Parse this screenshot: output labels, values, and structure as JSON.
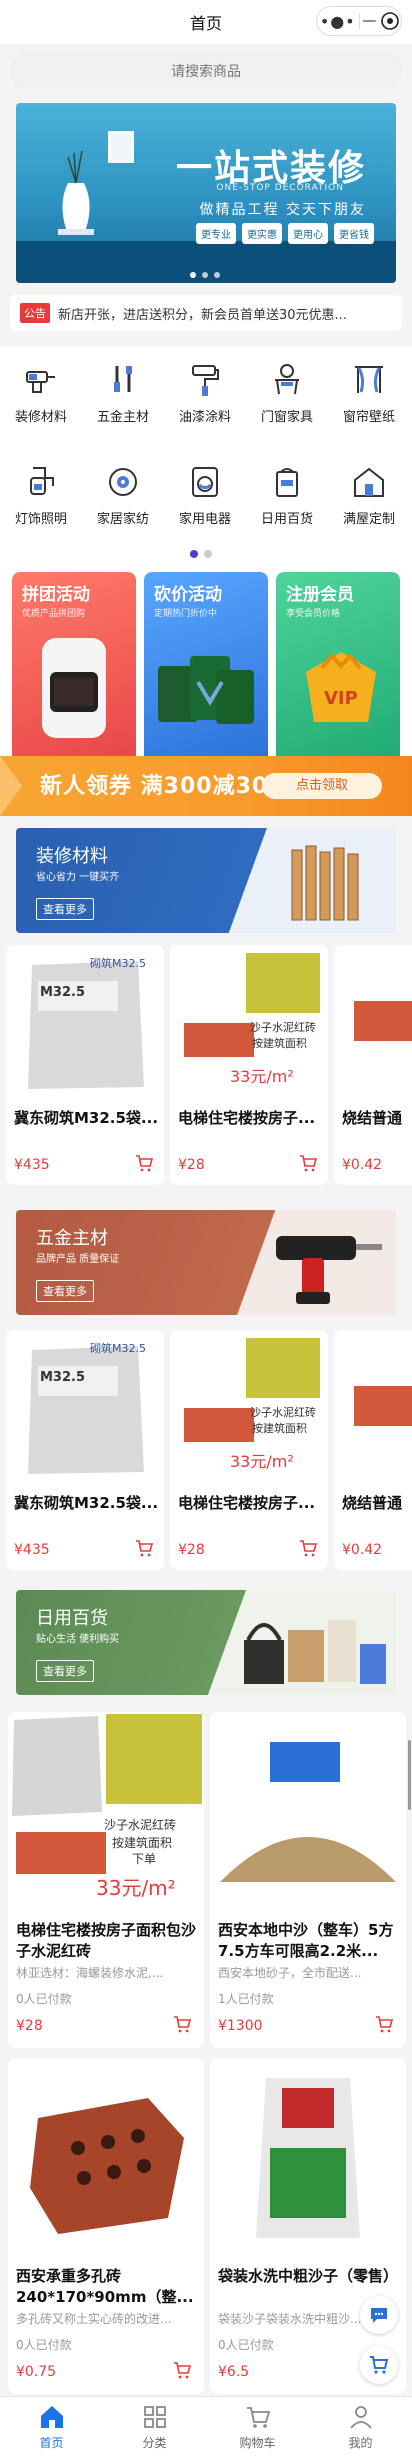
{
  "header": {
    "title": "首页",
    "more_icon": "more-dots-icon",
    "close_icon": "target-circle-icon"
  },
  "search": {
    "placeholder": "请搜索商品"
  },
  "banner": {
    "headline": "一站式装修",
    "sub_en": "ONE-STOP DECORATION",
    "slogan": "做精品工程  交天下朋友",
    "tags": [
      "更专业",
      "更实惠",
      "更用心",
      "更省钱"
    ]
  },
  "notice": {
    "badge": "公告",
    "text": "新店开张，进店送积分，新会员首单送30元优惠..."
  },
  "categories": [
    {
      "label": "装修材料",
      "icon": "drill-icon"
    },
    {
      "label": "五金主材",
      "icon": "tools-icon"
    },
    {
      "label": "油漆涂料",
      "icon": "paint-roller-icon"
    },
    {
      "label": "门窗家具",
      "icon": "dresser-icon"
    },
    {
      "label": "窗帘壁纸",
      "icon": "curtain-icon"
    },
    {
      "label": "灯饰照明",
      "icon": "faucet-icon"
    },
    {
      "label": "家居家纺",
      "icon": "speaker-icon"
    },
    {
      "label": "家用电器",
      "icon": "washer-icon"
    },
    {
      "label": "日用百货",
      "icon": "tissue-icon"
    },
    {
      "label": "满屋定制",
      "icon": "house-icon"
    }
  ],
  "promos": [
    {
      "title": "拼团活动",
      "sub": "优质产品拼团购",
      "color": "#ef5a5a"
    },
    {
      "title": "砍价活动",
      "sub": "定期热门折价中",
      "color": "#3b8ff1"
    },
    {
      "title": "注册会员",
      "sub": "享受会员价格",
      "color": "#2fbd84"
    }
  ],
  "coupon": {
    "text": "新人领券 满300减30/",
    "button": "点击领取"
  },
  "sections": [
    {
      "title": "装修材料",
      "sub": "省心省力 一键买齐",
      "button": "查看更多",
      "color": "#2a64b8"
    },
    {
      "title": "五金主材",
      "sub": "品牌产品 质量保证",
      "button": "查看更多",
      "color": "#b86147"
    },
    {
      "title": "日用百货",
      "sub": "贴心生活 便利购买",
      "button": "查看更多",
      "color": "#5f8f57"
    }
  ],
  "row_products": [
    {
      "name": "冀东砌筑M32.5袋...",
      "price": "¥435"
    },
    {
      "name": "电梯住宅楼按房子...",
      "price": "¥28"
    },
    {
      "name": "烧结普通",
      "price": "¥0.42"
    }
  ],
  "image_texts": {
    "cement_label": "砌筑M32.5",
    "brick_line1": "沙子水泥红砖",
    "brick_line2": "按建筑面积",
    "brick_line3": "下单",
    "brick_price": "33元/m²",
    "cement_bag": "M32.5"
  },
  "grid_products": [
    {
      "name": "电梯住宅楼按房子面积包沙子水泥红砖",
      "desc": "林亚选材：海螺装修水泥,...",
      "sold": "0人已付款",
      "price": "¥28"
    },
    {
      "name": "西安本地中沙（整车）5方7.5方车可限高2.2米...",
      "desc": "西安本地砂子，全市配送...",
      "sold": "1人已付款",
      "price": "¥1300"
    },
    {
      "name": "西安承重多孔砖240*170*90mm（整...",
      "desc": "多孔砖又称土实心砖的改进...",
      "sold": "0人已付款",
      "price": "¥0.75"
    },
    {
      "name": "袋装水洗中粗沙子（零售）",
      "desc": "袋装沙子袋装水洗中粗沙...",
      "sold": "0人已付款",
      "price": "¥6.5"
    }
  ],
  "tabbar": [
    {
      "label": "首页",
      "icon": "home-icon"
    },
    {
      "label": "分类",
      "icon": "grid-icon"
    },
    {
      "label": "购物车",
      "icon": "cart-icon"
    },
    {
      "label": "我的",
      "icon": "user-icon"
    }
  ],
  "colors": {
    "accent": "#1a73e8",
    "price": "#e63b3b",
    "coupon": "#f7a532"
  }
}
